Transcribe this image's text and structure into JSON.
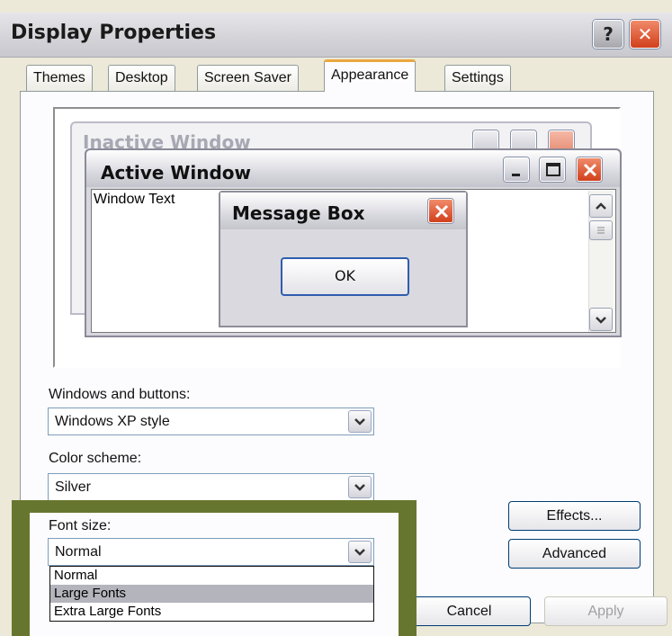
{
  "window": {
    "title": "Display Properties",
    "help_glyph": "?",
    "close_glyph": "✕"
  },
  "tabs": [
    {
      "label": "Themes"
    },
    {
      "label": "Desktop"
    },
    {
      "label": "Screen Saver"
    },
    {
      "label": "Appearance",
      "active": true
    },
    {
      "label": "Settings"
    }
  ],
  "preview": {
    "inactive_window_title": "Inactive Window",
    "active_window_title": "Active Window",
    "window_text": "Window Text",
    "message_box_title": "Message Box",
    "ok_label": "OK"
  },
  "windows_and_buttons": {
    "label": "Windows and buttons:",
    "value": "Windows XP style"
  },
  "color_scheme": {
    "label": "Color scheme:",
    "value": "Silver"
  },
  "font_size": {
    "label": "Font size:",
    "value": "Normal",
    "options": [
      "Normal",
      "Large Fonts",
      "Extra Large Fonts"
    ],
    "highlighted_option": "Large Fonts"
  },
  "buttons": {
    "effects": "Effects...",
    "advanced": "Advanced",
    "cancel": "Cancel",
    "apply": "Apply"
  },
  "colors": {
    "highlight_frame": "#67762f",
    "tab_accent": "#e9a840",
    "close_red": "#d1401c"
  }
}
